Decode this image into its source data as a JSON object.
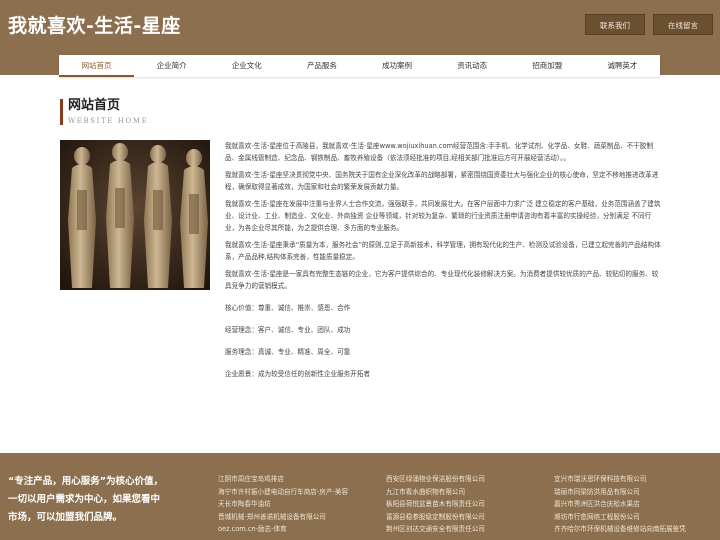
{
  "header": {
    "title": "我就喜欢-生活-星座",
    "contact_label": "联系我们",
    "message_label": "在线留言"
  },
  "nav": [
    {
      "label": "网站首页"
    },
    {
      "label": "企业简介"
    },
    {
      "label": "企业文化"
    },
    {
      "label": "产品服务"
    },
    {
      "label": "成功案例"
    },
    {
      "label": "资讯动态"
    },
    {
      "label": "招商加盟"
    },
    {
      "label": "诚聘英才"
    }
  ],
  "section": {
    "title_zh": "网站首页",
    "title_en": "WEBSITE HOME"
  },
  "content": {
    "paragraphs": [
      "我就喜欢-生活-星座位于高陵县，我就喜欢-生活-星座www.wojiuxihuan.com经营范围含:手手机、化学试剂、化学品、女鞋、蔬菜制品、不干胶制品、金属线管制造、纪念品、钢铁制品、畜牧养殖设备（依法须经批准的项目,经相关部门批准后方可开展经营活动）。。",
      "我就喜欢-生活-星座坚决贯彻党中央、国务院关于国有企业深化改革的战略部署，紧密围绕国资委壮大与强化企业的核心使命，坚定不移地推进改革进程，确保取得显著成效，为国家和社会的繁荣发展贡献力量。",
      "我就喜欢-生活-星座在发展中注重与业界人士合作交流，强强联手，共同发展壮大。在客户层面中力求广泛 建立稳定的客户基础，业务范围涵盖了建筑业、设计业、工业、制造业、文化业、外商独资 企业等领域，针对较为复杂、繁琐的行业资质注册申请咨询有着丰富的实操经验，分别满足 不同行业，为各企业尽其所能，为之提供合理、多方面的专业服务。",
      "我就喜欢-生活-星座秉承“质量为本，服务社会”的原则,立足于高新技术，科学管理，拥有现代化的生产、检测及试验设备，已建立起完善的产品结构体系，产品品种,结构体系完善，性能质量稳定。",
      "我就喜欢-生活-星座是一家具有完整生态链的企业，它为客户提供综合的、专业现代化装修解决方案。为消费者提供较优质的产品、较贴切的服务、较具竞争力的营销模式。",
      "核心价值：尊重、诚信、推崇、感恩、合作",
      "经营理念：客户、诚信、专业、团队、成功",
      "服务理念：真诚、专业、精准、周全、可靠",
      "企业愿景：成为较受信任的创新性企业服务开拓者"
    ]
  },
  "footer": {
    "slogan": "“专注产品，用心服务”为核心价值，一切以用户需求为中心，如果您看中市场，可以加盟我们品牌。",
    "col1": [
      "江阴市周庄宝岛鸡排店",
      "海宁市许村振小建电动自行车商店-房产-美容",
      "天长市陶春华油坊",
      "晋城机械-郑州善诺机械设备有限公司",
      "oez.com.cn-励志-体育"
    ],
    "col2": [
      "西安区绿涌物业保洁股份有限公司",
      "九江市看水曲织物有限公司",
      "枞阳县荷悦盆景苗木有限责任公司",
      "富源县稳参股级定制股份有限公司",
      "荆州区创达交通安全有限责任公司"
    ],
    "col3": [
      "宜兴市瑞沃思环保科技有限公司",
      "瑞丽市同梁防洪用品有限公司",
      "嘉兴市秀洲区洪合庆松水果店",
      "潍坊市行愈网络工程股份公司",
      "齐齐哈尔市环保机械设备维修站向南拓展鉴凭"
    ]
  },
  "colors": {
    "brand_brown": "#8b6f4e",
    "button_dark": "#6b4f31",
    "accent": "#8b3a1e"
  }
}
